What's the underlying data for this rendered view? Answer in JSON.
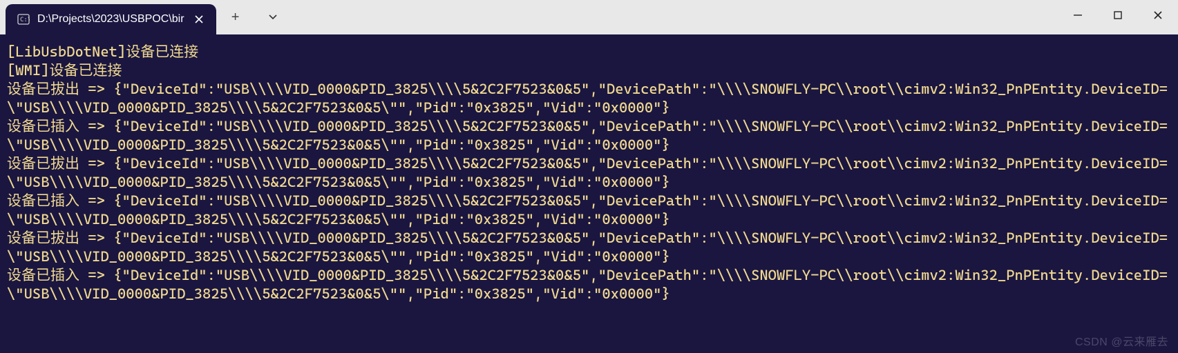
{
  "titlebar": {
    "tab_title": "D:\\Projects\\2023\\USBPOC\\bir",
    "new_tab_label": "+",
    "dropdown_label": "⌄"
  },
  "terminal": {
    "lines": [
      "[LibUsbDotNet]设备已连接",
      "[WMI]设备已连接",
      "设备已拔出 => {\"DeviceId\":\"USB\\\\\\\\VID_0000&PID_3825\\\\\\\\5&2C2F7523&0&5\",\"DevicePath\":\"\\\\\\\\SNOWFLY-PC\\\\root\\\\cimv2:Win32_PnPEntity.DeviceID=\\\"USB\\\\\\\\VID_0000&PID_3825\\\\\\\\5&2C2F7523&0&5\\\"\",\"Pid\":\"0x3825\",\"Vid\":\"0x0000\"}",
      "设备已插入 => {\"DeviceId\":\"USB\\\\\\\\VID_0000&PID_3825\\\\\\\\5&2C2F7523&0&5\",\"DevicePath\":\"\\\\\\\\SNOWFLY-PC\\\\root\\\\cimv2:Win32_PnPEntity.DeviceID=\\\"USB\\\\\\\\VID_0000&PID_3825\\\\\\\\5&2C2F7523&0&5\\\"\",\"Pid\":\"0x3825\",\"Vid\":\"0x0000\"}",
      "设备已拔出 => {\"DeviceId\":\"USB\\\\\\\\VID_0000&PID_3825\\\\\\\\5&2C2F7523&0&5\",\"DevicePath\":\"\\\\\\\\SNOWFLY-PC\\\\root\\\\cimv2:Win32_PnPEntity.DeviceID=\\\"USB\\\\\\\\VID_0000&PID_3825\\\\\\\\5&2C2F7523&0&5\\\"\",\"Pid\":\"0x3825\",\"Vid\":\"0x0000\"}",
      "设备已插入 => {\"DeviceId\":\"USB\\\\\\\\VID_0000&PID_3825\\\\\\\\5&2C2F7523&0&5\",\"DevicePath\":\"\\\\\\\\SNOWFLY-PC\\\\root\\\\cimv2:Win32_PnPEntity.DeviceID=\\\"USB\\\\\\\\VID_0000&PID_3825\\\\\\\\5&2C2F7523&0&5\\\"\",\"Pid\":\"0x3825\",\"Vid\":\"0x0000\"}",
      "设备已拔出 => {\"DeviceId\":\"USB\\\\\\\\VID_0000&PID_3825\\\\\\\\5&2C2F7523&0&5\",\"DevicePath\":\"\\\\\\\\SNOWFLY-PC\\\\root\\\\cimv2:Win32_PnPEntity.DeviceID=\\\"USB\\\\\\\\VID_0000&PID_3825\\\\\\\\5&2C2F7523&0&5\\\"\",\"Pid\":\"0x3825\",\"Vid\":\"0x0000\"}",
      "设备已插入 => {\"DeviceId\":\"USB\\\\\\\\VID_0000&PID_3825\\\\\\\\5&2C2F7523&0&5\",\"DevicePath\":\"\\\\\\\\SNOWFLY-PC\\\\root\\\\cimv2:Win32_PnPEntity.DeviceID=\\\"USB\\\\\\\\VID_0000&PID_3825\\\\\\\\5&2C2F7523&0&5\\\"\",\"Pid\":\"0x3825\",\"Vid\":\"0x0000\"}"
    ]
  },
  "watermark": "CSDN @云来雁去"
}
